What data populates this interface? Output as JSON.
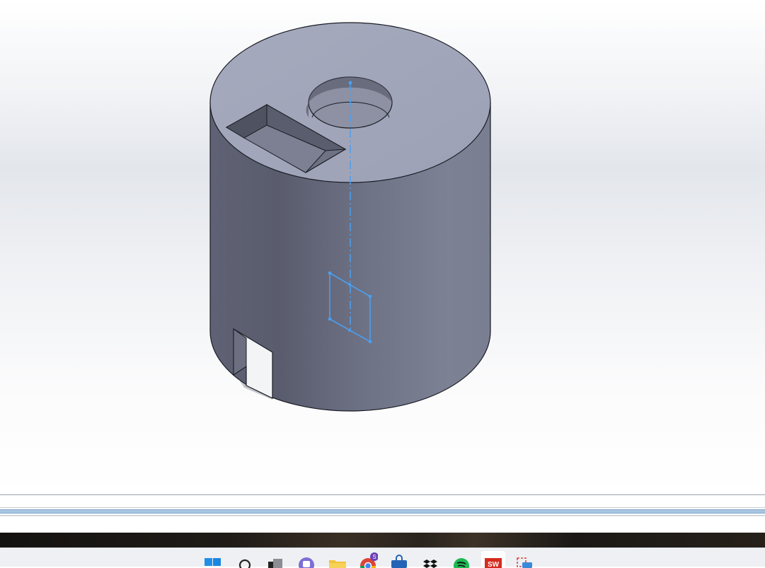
{
  "viewport": {
    "part": {
      "body_color": "#7b7f92",
      "top_face_color": "#a3a7bc",
      "edge_color": "#1a1c24",
      "sketch_color": "#4a9ff0"
    }
  },
  "statusbar": {},
  "taskbar": {
    "items": [
      {
        "icon": "windows-start-icon",
        "interactable": true
      },
      {
        "icon": "search-icon",
        "interactable": true
      },
      {
        "icon": "task-view-icon",
        "interactable": true
      },
      {
        "icon": "teams-chat-icon",
        "interactable": true
      },
      {
        "icon": "file-explorer-icon",
        "interactable": true
      },
      {
        "icon": "chrome-icon",
        "interactable": true,
        "badge": "S"
      },
      {
        "icon": "microsoft-store-icon",
        "interactable": true
      },
      {
        "icon": "dropbox-icon",
        "interactable": true
      },
      {
        "icon": "spotify-icon",
        "interactable": true
      },
      {
        "icon": "solidworks-icon",
        "interactable": true,
        "active": true,
        "label": "SW"
      },
      {
        "icon": "snipping-tool-icon",
        "interactable": true
      }
    ]
  }
}
